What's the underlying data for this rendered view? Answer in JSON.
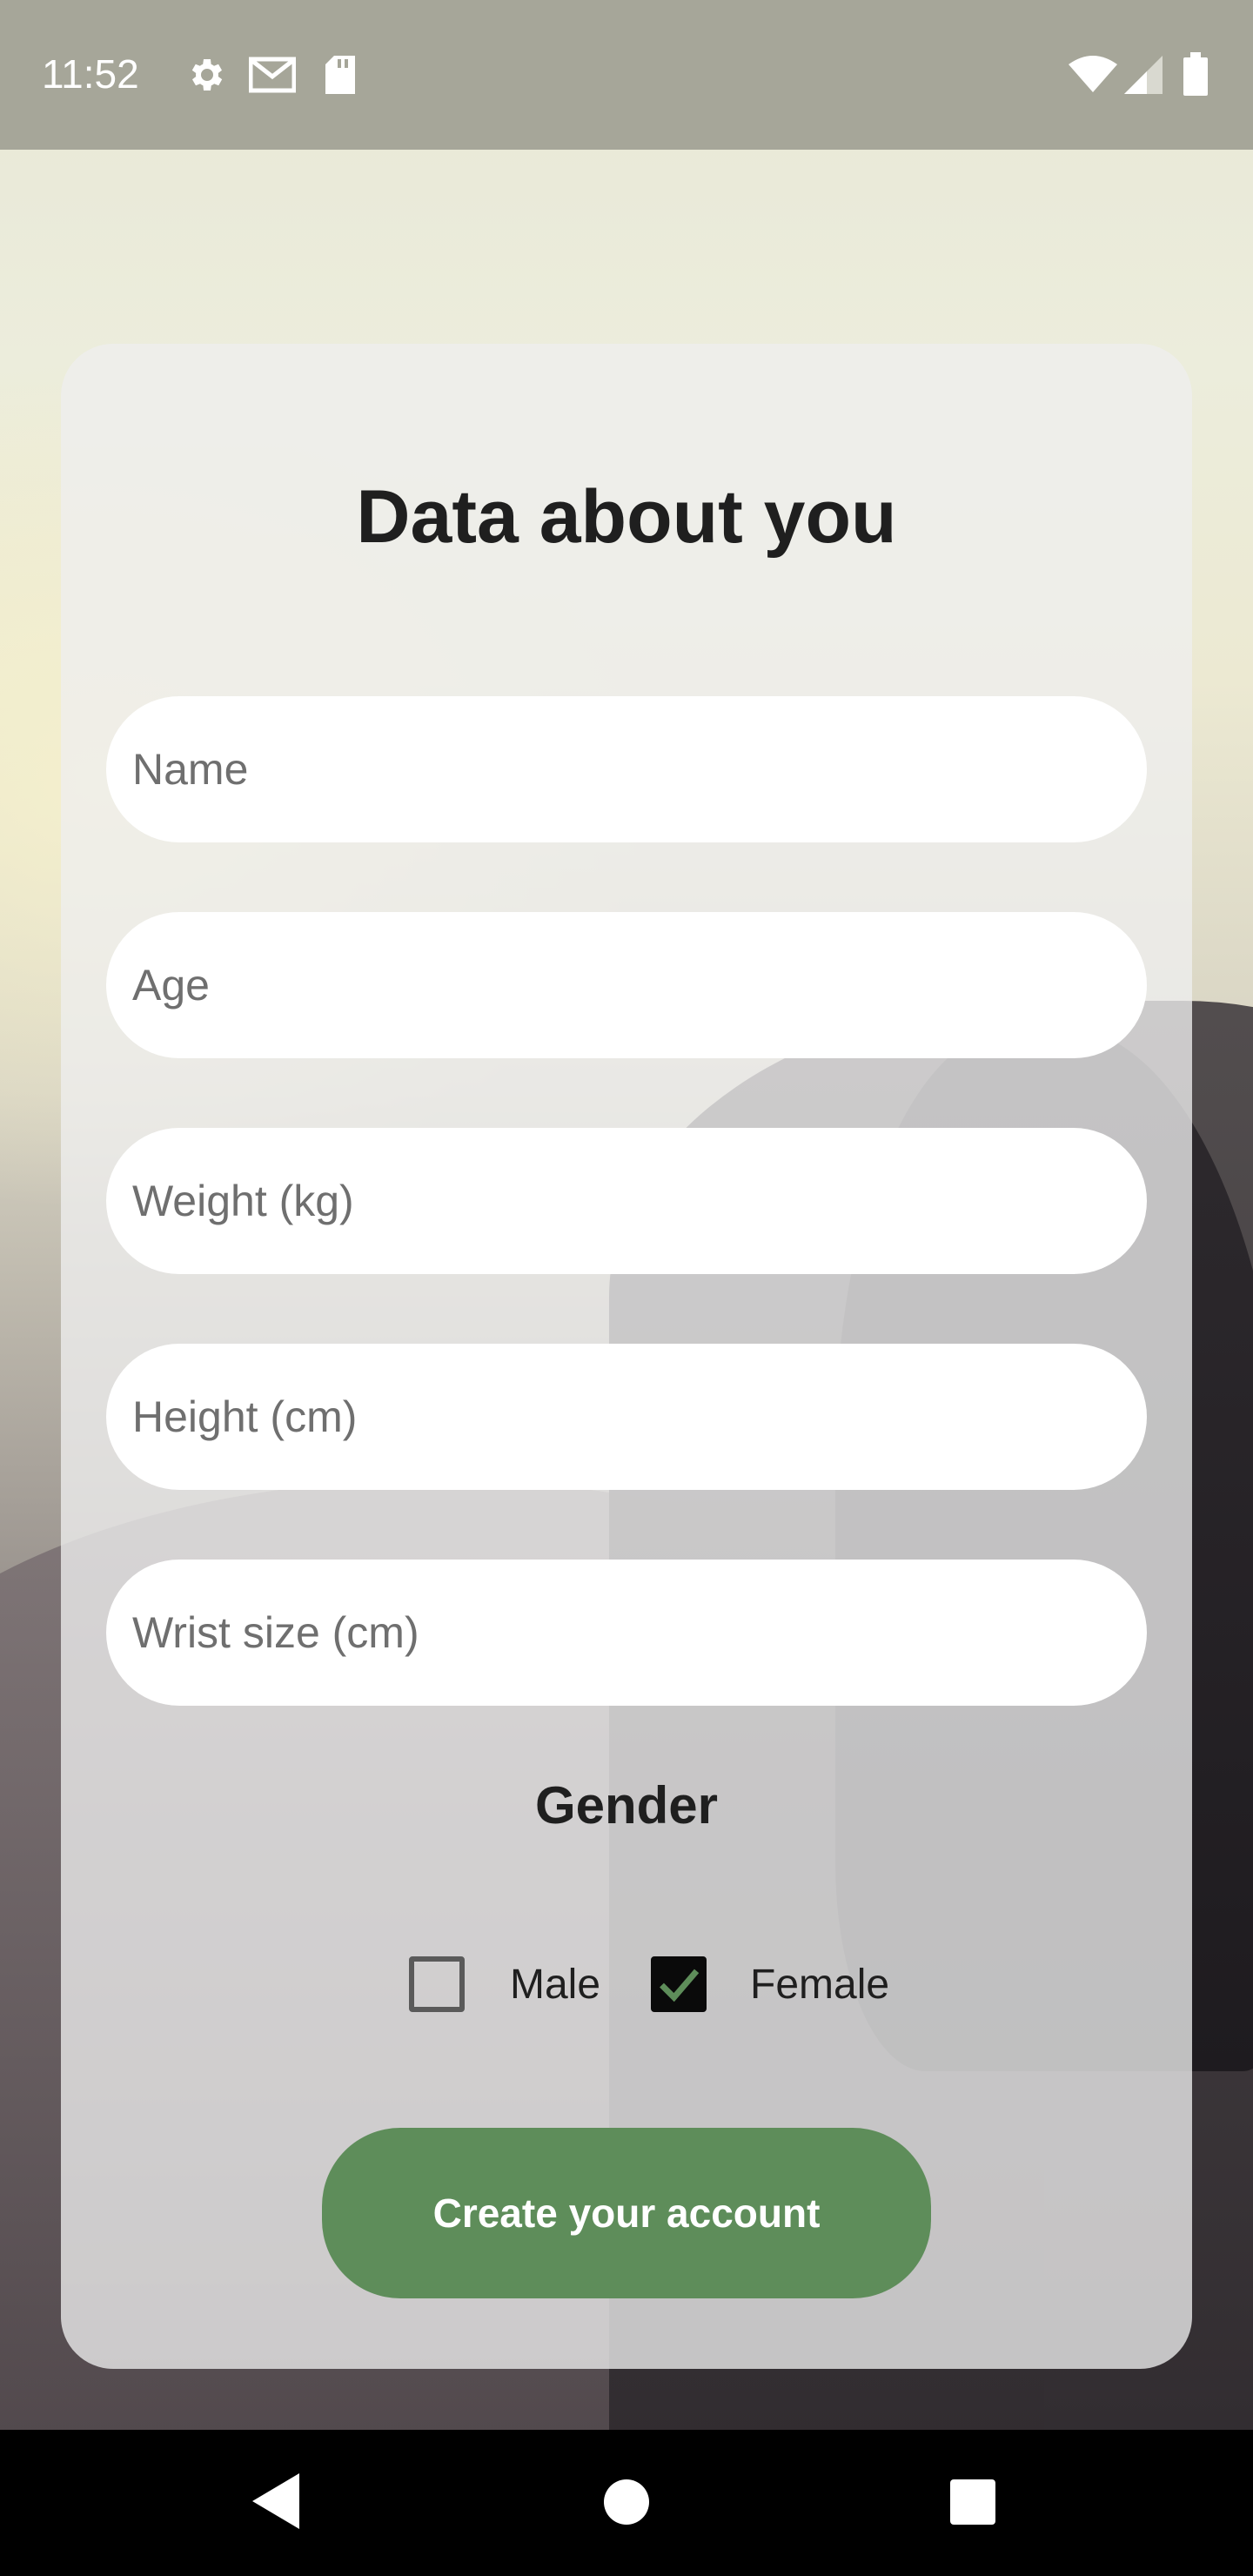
{
  "status_bar": {
    "time": "11:52",
    "left_icons": [
      "gear-icon",
      "gmail-icon",
      "sd-card-icon"
    ],
    "right_icons": [
      "wifi-icon",
      "signal-icon",
      "battery-icon"
    ]
  },
  "form": {
    "title": "Data about you",
    "fields": [
      {
        "name": "name",
        "placeholder": "Name",
        "value": ""
      },
      {
        "name": "age",
        "placeholder": "Age",
        "value": ""
      },
      {
        "name": "weight",
        "placeholder": "Weight (kg)",
        "value": ""
      },
      {
        "name": "height",
        "placeholder": "Height (cm)",
        "value": ""
      },
      {
        "name": "wrist",
        "placeholder": "Wrist size (cm)",
        "value": ""
      }
    ],
    "gender": {
      "label": "Gender",
      "options": [
        {
          "label": "Male",
          "checked": false
        },
        {
          "label": "Female",
          "checked": true
        }
      ]
    },
    "submit_label": "Create your account"
  },
  "nav_bar": {
    "buttons": [
      "back-icon",
      "home-icon",
      "recents-icon"
    ]
  },
  "colors": {
    "accent": "#5e8d5a",
    "status_bar": "#a6a699",
    "card": "#eeeeee"
  }
}
